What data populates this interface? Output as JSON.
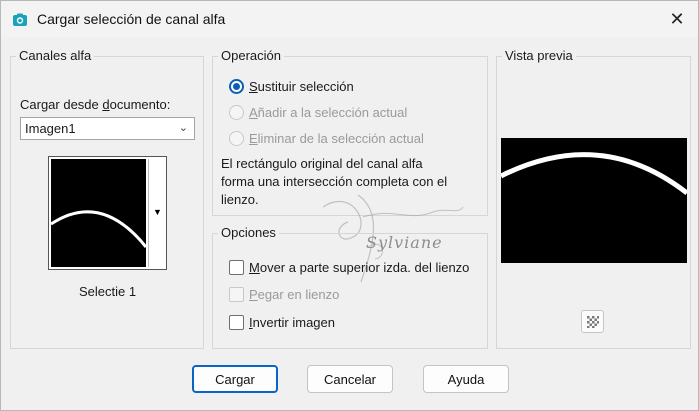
{
  "window": {
    "title": "Cargar selección de canal alfa",
    "close_glyph": "✕",
    "app_icon": "camera-icon"
  },
  "canales": {
    "group_label": "Canales alfa",
    "load_label_prefix": "Cargar desde ",
    "load_label_accel": "d",
    "load_label_suffix": "ocumento:",
    "select_value": "Imagen1",
    "thumb_caption": "Selectie 1"
  },
  "operacion": {
    "group_label": "Operación",
    "options": [
      {
        "accel": "S",
        "rest": "ustituir selección",
        "checked": true,
        "disabled": false
      },
      {
        "accel": "A",
        "rest": "ñadir a la selección actual",
        "checked": false,
        "disabled": true
      },
      {
        "accel": "E",
        "rest": "liminar de la selección actual",
        "checked": false,
        "disabled": true
      }
    ],
    "description_lines": [
      "El rectángulo original del canal alfa",
      "forma una intersección completa con el",
      "lienzo."
    ]
  },
  "opciones": {
    "group_label": "Opciones",
    "options": [
      {
        "accel": "M",
        "rest": "over a parte superior izda. del lienzo",
        "checked": false,
        "disabled": false
      },
      {
        "accel": "P",
        "rest": "egar en lienzo",
        "checked": false,
        "disabled": true
      },
      {
        "accel": "I",
        "rest": "nvertir imagen",
        "checked": false,
        "disabled": false
      }
    ]
  },
  "vista": {
    "group_label": "Vista previa"
  },
  "watermark": {
    "text": "Sylviane"
  },
  "buttons": {
    "ok": "Cargar",
    "cancel": "Cancelar",
    "help": "Ayuda"
  },
  "colors": {
    "accent": "#0a5fb4",
    "app_icon": "#1aa3b8"
  }
}
